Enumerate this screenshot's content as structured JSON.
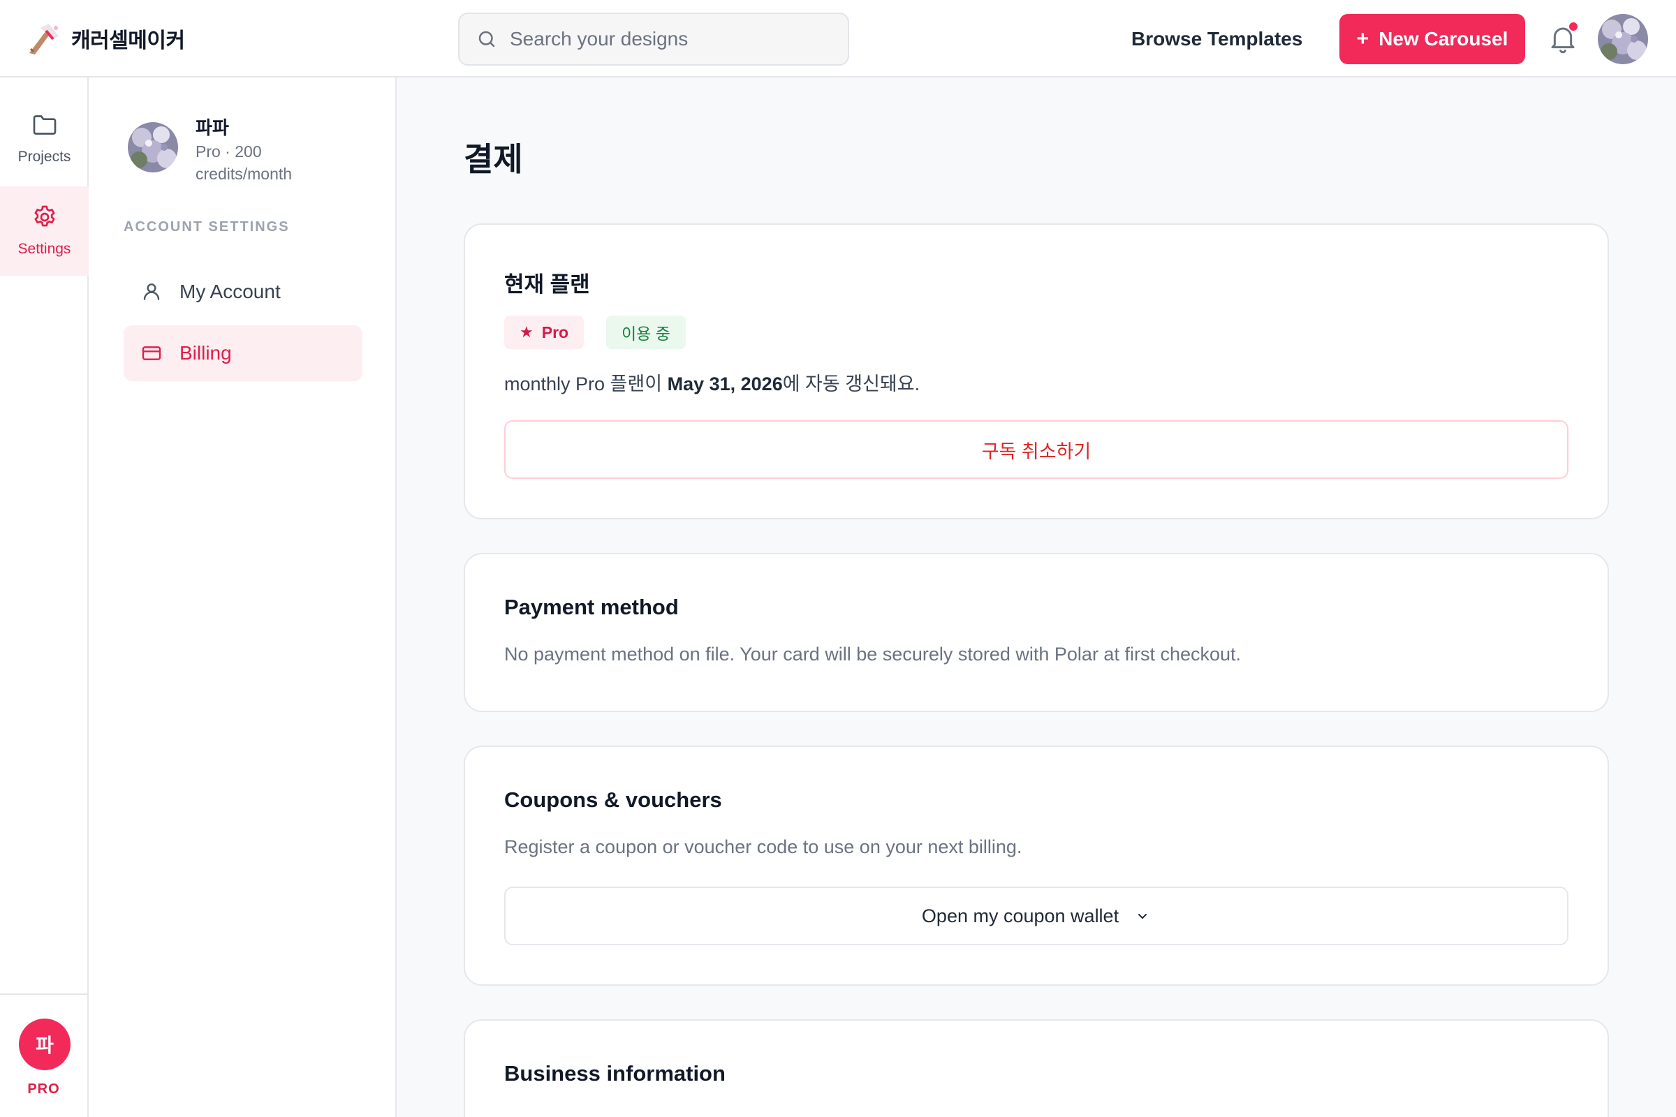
{
  "header": {
    "app_name": "캐러셀메이커",
    "search_placeholder": "Search your designs",
    "browse_label": "Browse Templates",
    "new_button_plus": "+",
    "new_button_label": "New Carousel"
  },
  "rail": {
    "items": [
      {
        "label": "Projects",
        "icon": "folder-icon"
      },
      {
        "label": "Settings",
        "icon": "gear-icon"
      }
    ],
    "user_initial": "파",
    "badge": "PRO"
  },
  "sidebar": {
    "profile_name": "파파",
    "profile_plan": "Pro · 200 credits/month",
    "section_title": "ACCOUNT SETTINGS",
    "items": [
      {
        "label": "My Account",
        "icon": "user-icon"
      },
      {
        "label": "Billing",
        "icon": "credit-card-icon"
      }
    ]
  },
  "main": {
    "page_title": "결제",
    "plan_card": {
      "title": "현재 플랜",
      "badge_star": "★",
      "badge_plan": "Pro",
      "badge_status": "이용 중",
      "renew_prefix": "monthly Pro 플랜이 ",
      "renew_date": "May 31, 2026",
      "renew_suffix": "에 자동 갱신돼요.",
      "cancel_label": "구독 취소하기"
    },
    "payment_card": {
      "title": "Payment method",
      "description": "No payment method on file. Your card will be securely stored with Polar at first checkout."
    },
    "coupon_card": {
      "title": "Coupons & vouchers",
      "description": "Register a coupon or voucher code to use on your next billing.",
      "wallet_label": "Open my coupon wallet"
    },
    "business_card": {
      "title": "Business information"
    }
  },
  "colors": {
    "accent": "#f12a5a",
    "accent_soft": "#fdeef2",
    "success": "#15803d",
    "success_soft": "#eaf8ee"
  }
}
